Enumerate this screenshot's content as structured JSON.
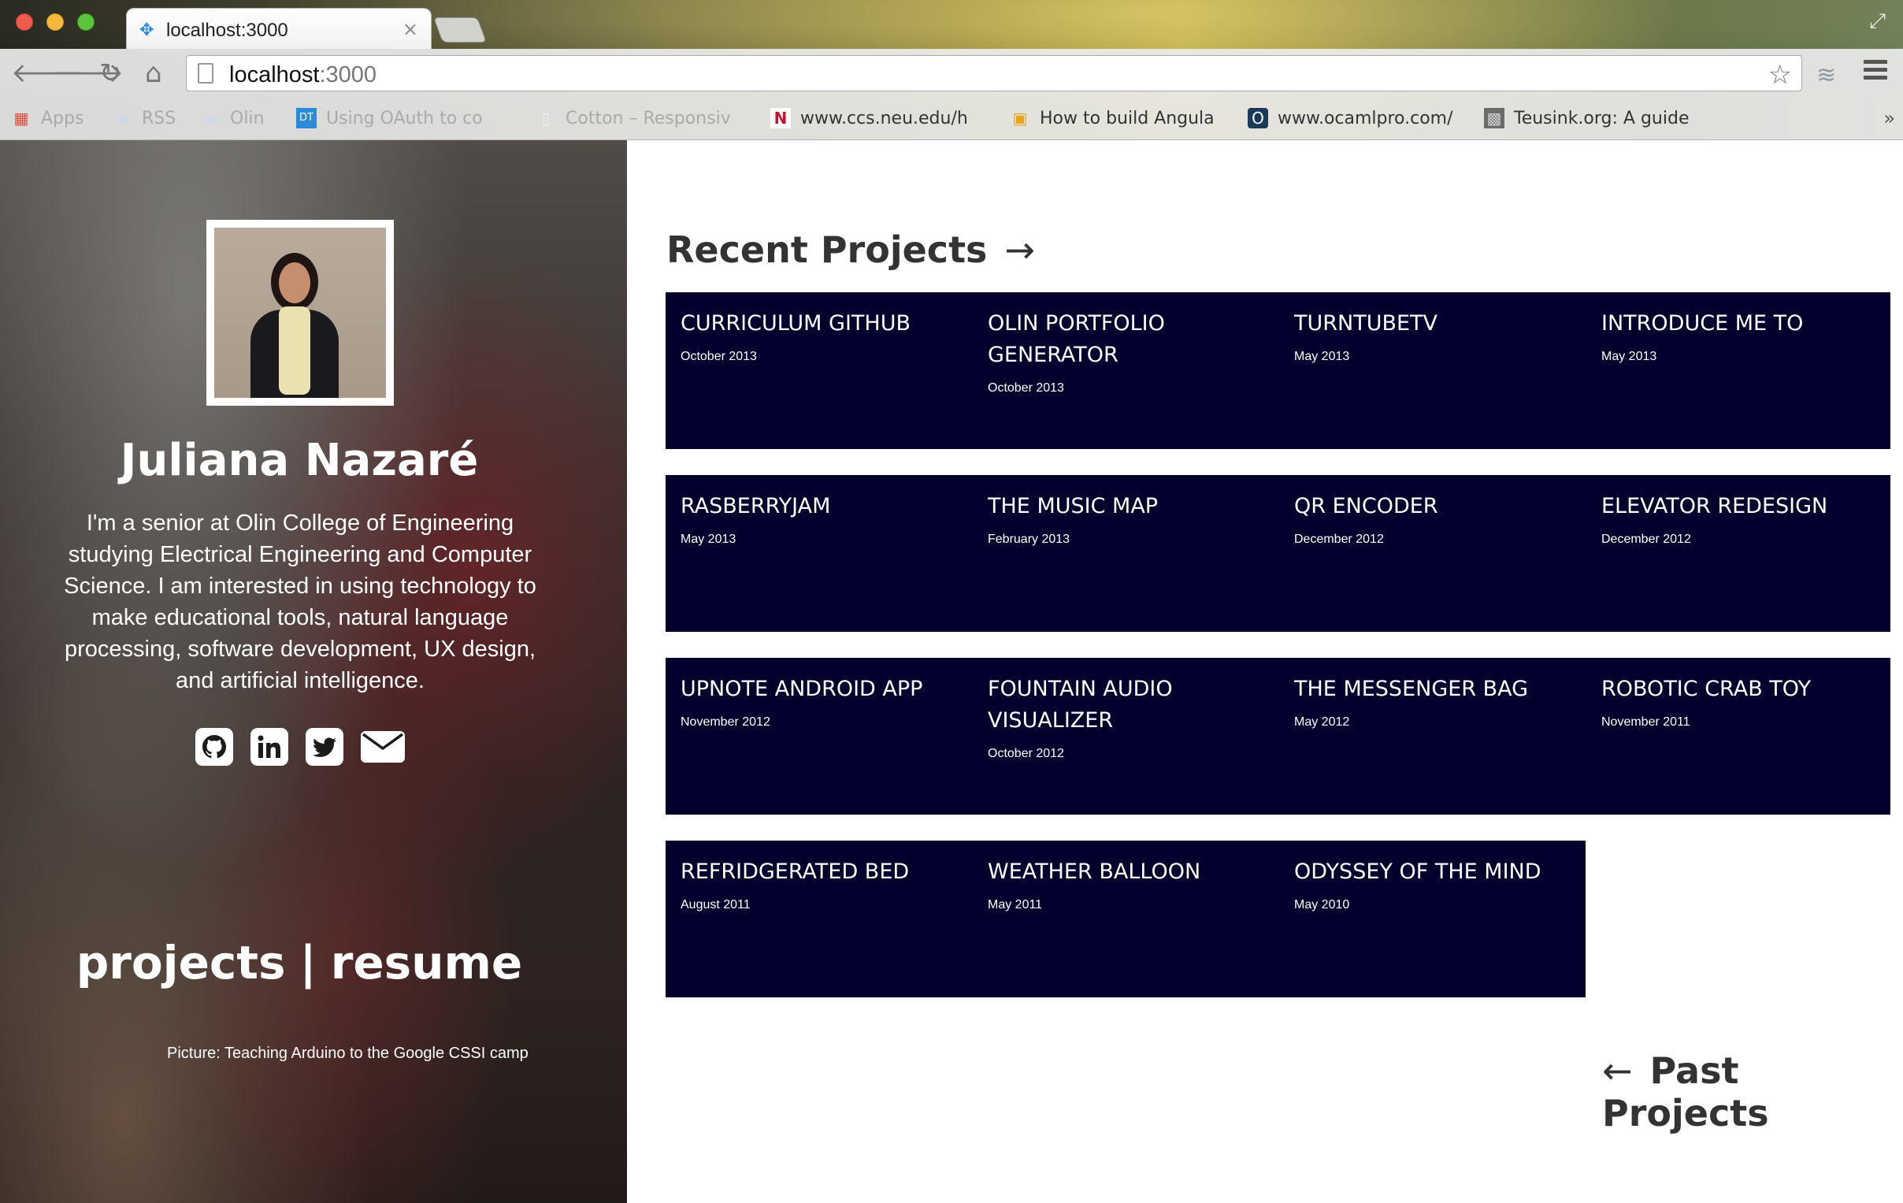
{
  "browser": {
    "tab": {
      "title": "localhost:3000",
      "favicon": "puzzle-icon",
      "close": "×"
    },
    "url": {
      "host": "localhost",
      "port": ":3000"
    },
    "bookmarks": [
      {
        "label": "Apps",
        "icon": "apps-grid-icon",
        "faded": true
      },
      {
        "label": "RSS",
        "icon": "folder-icon",
        "faded": true
      },
      {
        "label": "Olin",
        "icon": "folder-icon",
        "faded": true
      },
      {
        "label": "Using OAuth to co",
        "icon": "dt-icon",
        "faded": true
      },
      {
        "label": "Cotton – Responsiv",
        "icon": "page-icon",
        "faded": true
      },
      {
        "label": "www.ccs.neu.edu/h",
        "icon": "n-logo-icon",
        "faded": false
      },
      {
        "label": "How to build Angula",
        "icon": "orange-box-icon",
        "faded": false
      },
      {
        "label": "www.ocamlpro.com/",
        "icon": "o-logo-icon",
        "faded": false
      },
      {
        "label": "Teusink.org: A guide",
        "icon": "photo-icon",
        "faded": false
      }
    ],
    "bookmarks_more": "»"
  },
  "profile": {
    "name": "Juliana Nazaré",
    "bio": "I'm a senior at Olin College of Engineering studying Electrical Engineering and Computer Science. I am interested in using technology to make educational tools, natural language processing, software development, UX design, and artificial intelligence.",
    "socials": [
      "github-icon",
      "linkedin-icon",
      "twitter-icon",
      "envelope-icon"
    ],
    "nav": {
      "projects": "projects",
      "separator": "|",
      "resume": "resume"
    },
    "caption": "Picture: Teaching Arduino to the Google CSSI camp"
  },
  "main": {
    "recent_title": "Recent Projects",
    "recent_arrow": "→",
    "past_title": "Past Projects",
    "past_arrow": "←",
    "tile_color": "#03002d",
    "rows": [
      [
        {
          "name": "CURRICULUM GITHUB",
          "date": "October 2013"
        },
        {
          "name": "OLIN PORTFOLIO GENERATOR",
          "date": "October 2013"
        },
        {
          "name": "TURNTUBETV",
          "date": "May 2013"
        },
        {
          "name": "INTRODUCE ME TO",
          "date": "May 2013"
        }
      ],
      [
        {
          "name": "RASBERRYJAM",
          "date": "May 2013"
        },
        {
          "name": "THE MUSIC MAP",
          "date": "February 2013"
        },
        {
          "name": "QR ENCODER",
          "date": "December 2012"
        },
        {
          "name": "ELEVATOR REDESIGN",
          "date": "December 2012"
        }
      ],
      [
        {
          "name": "UPNOTE ANDROID APP",
          "date": "November 2012"
        },
        {
          "name": "FOUNTAIN AUDIO VISUALIZER",
          "date": "October 2012"
        },
        {
          "name": "THE MESSENGER BAG",
          "date": "May 2012"
        },
        {
          "name": "ROBOTIC CRAB TOY",
          "date": "November 2011"
        }
      ],
      [
        {
          "name": "REFRIDGERATED BED",
          "date": "August 2011"
        },
        {
          "name": "WEATHER BALLOON",
          "date": "May 2011"
        },
        {
          "name": "ODYSSEY OF THE MIND",
          "date": "May 2010"
        }
      ]
    ]
  }
}
